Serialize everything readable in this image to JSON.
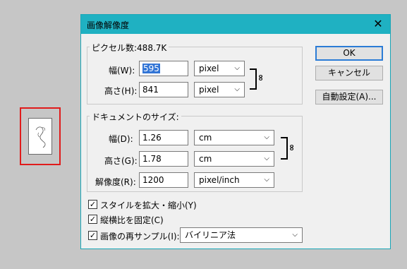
{
  "dialog": {
    "title": "画像解像度",
    "close_icon": "✕"
  },
  "pixel_dims": {
    "label": "ピクセル数:488.7K",
    "width_label": "幅(W):",
    "width_value": "595",
    "width_unit": "pixel",
    "height_label": "高さ(H):",
    "height_value": "841",
    "height_unit": "pixel"
  },
  "doc_size": {
    "label": "ドキュメントのサイズ:",
    "width_label": "幅(D):",
    "width_value": "1.26",
    "width_unit": "cm",
    "height_label": "高さ(G):",
    "height_value": "1.78",
    "height_unit": "cm",
    "res_label": "解像度(R):",
    "res_value": "1200",
    "res_unit": "pixel/inch"
  },
  "buttons": {
    "ok": "OK",
    "cancel": "キャンセル",
    "auto": "自動設定(A)..."
  },
  "options": {
    "scale_styles": "スタイルを拡大・縮小(Y)",
    "constrain": "縦横比を固定(C)",
    "resample": "画像の再サンプル(I):",
    "resample_method": "バイリニア法",
    "check_glyph": "✓"
  },
  "icons": {
    "link": "∞",
    "chevron": "⌵"
  },
  "colors": {
    "titlebar": "#1fb1c2",
    "highlight": "#3275d6",
    "thumbnail_border": "#e01b1b"
  }
}
